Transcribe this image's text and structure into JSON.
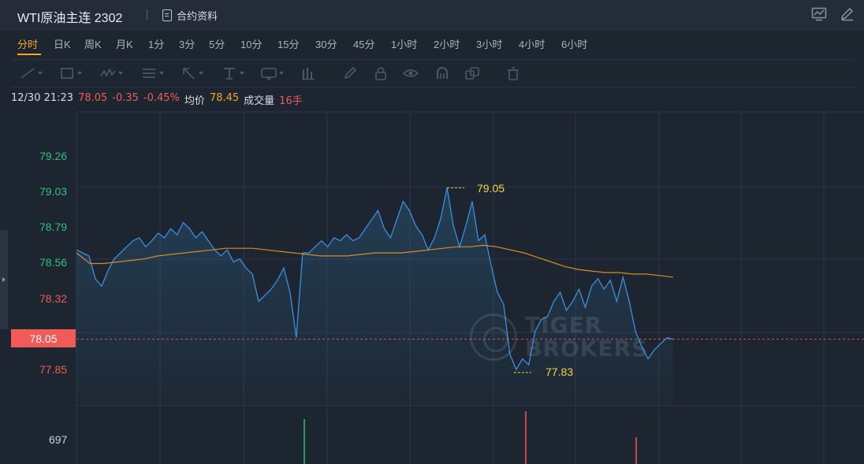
{
  "header": {
    "title": "WTI原油主连 2302",
    "contract_info_label": "合约资料",
    "icons": [
      "chart-settings-icon",
      "edit-icon"
    ]
  },
  "timeframes": [
    "分时",
    "日K",
    "周K",
    "月K",
    "1分",
    "3分",
    "5分",
    "10分",
    "15分",
    "30分",
    "45分",
    "1小时",
    "2小时",
    "3小时",
    "4小时",
    "6小时"
  ],
  "active_timeframe": "分时",
  "toolbar_icons": [
    "line-tool-icon",
    "rectangle-tool-icon",
    "wave-tool-icon",
    "fibonacci-tool-icon",
    "arrow-tool-icon",
    "text-tool-icon",
    "label-tool-icon",
    "measure-tool-icon",
    "pencil-icon",
    "lock-icon",
    "eye-icon",
    "magnet-icon",
    "clone-icon",
    "trash-icon"
  ],
  "info": {
    "datetime": "12/30 21:23",
    "price": "78.05",
    "change": "-0.35",
    "change_pct": "-0.45%",
    "avg_label": "均价",
    "avg_price": "78.45",
    "volume_label": "成交量",
    "volume": "16手"
  },
  "y_axis": {
    "ticks": [
      {
        "label": "79.26",
        "tone": "up"
      },
      {
        "label": "79.03",
        "tone": "up"
      },
      {
        "label": "78.79",
        "tone": "up"
      },
      {
        "label": "78.56",
        "tone": "up"
      },
      {
        "label": "78.32",
        "tone": "down"
      },
      {
        "label": "77.85",
        "tone": "down"
      }
    ],
    "current_price": "78.05",
    "volume_tick": "697"
  },
  "annotations": {
    "high": "79.05",
    "low": "77.83"
  },
  "watermark": {
    "line1": "TIGER",
    "line2": "BROKERS"
  },
  "colors": {
    "up": "#2ec07e",
    "down": "#f05a57",
    "price_line": "#3b8fe0",
    "avg_line": "#d98a2b",
    "accent": "#f5a623",
    "annotation": "#f5d547"
  },
  "chart_data": {
    "type": "line",
    "title": "",
    "ylim": [
      77.67,
      79.45
    ],
    "grid": true,
    "reference_price": 78.4,
    "current_price": 78.05,
    "series": [
      {
        "values": [
          78.64,
          78.62,
          78.6,
          78.45,
          78.4,
          78.5,
          78.58,
          78.62,
          78.66,
          78.7,
          78.72,
          78.66,
          78.7,
          78.75,
          78.72,
          78.78,
          78.74,
          78.82,
          78.78,
          78.72,
          78.76,
          78.7,
          78.64,
          78.6,
          78.64,
          78.56,
          78.58,
          78.52,
          78.48,
          78.3,
          78.34,
          78.38,
          78.44,
          78.52,
          78.36,
          78.06,
          78.62,
          78.62,
          78.66,
          78.7,
          78.66,
          78.72,
          78.7,
          78.74,
          78.7,
          78.72,
          78.78,
          78.84,
          78.9,
          78.78,
          78.72,
          78.84,
          78.96,
          78.9,
          78.8,
          78.74,
          78.64,
          78.72,
          78.85,
          79.05,
          78.8,
          78.66,
          78.8,
          78.96,
          78.7,
          78.74,
          78.54,
          78.36,
          78.28,
          77.95,
          77.85,
          77.92,
          77.88,
          78.1,
          78.18,
          78.2,
          78.3,
          78.36,
          78.24,
          78.3,
          78.38,
          78.26,
          78.4,
          78.45,
          78.38,
          78.44,
          78.3,
          78.46,
          78.3,
          78.1,
          78.0,
          77.92,
          77.98,
          78.02,
          78.06,
          78.05
        ]
      },
      {
        "values": [
          78.62,
          78.55,
          78.55,
          78.56,
          78.57,
          78.58,
          78.6,
          78.61,
          78.62,
          78.63,
          78.64,
          78.65,
          78.65,
          78.65,
          78.64,
          78.63,
          78.62,
          78.61,
          78.6,
          78.6,
          78.6,
          78.61,
          78.62,
          78.62,
          78.62,
          78.63,
          78.64,
          78.65,
          78.66,
          78.66,
          78.67,
          78.66,
          78.64,
          78.62,
          78.59,
          78.56,
          78.53,
          78.51,
          78.5,
          78.49,
          78.49,
          78.48,
          78.48,
          78.47,
          78.46
        ]
      }
    ],
    "annotations": [
      {
        "label": "79.05",
        "value": 79.05,
        "kind": "high"
      },
      {
        "label": "77.83",
        "value": 77.83,
        "kind": "low"
      }
    ],
    "volume": {
      "tick": "697"
    }
  }
}
